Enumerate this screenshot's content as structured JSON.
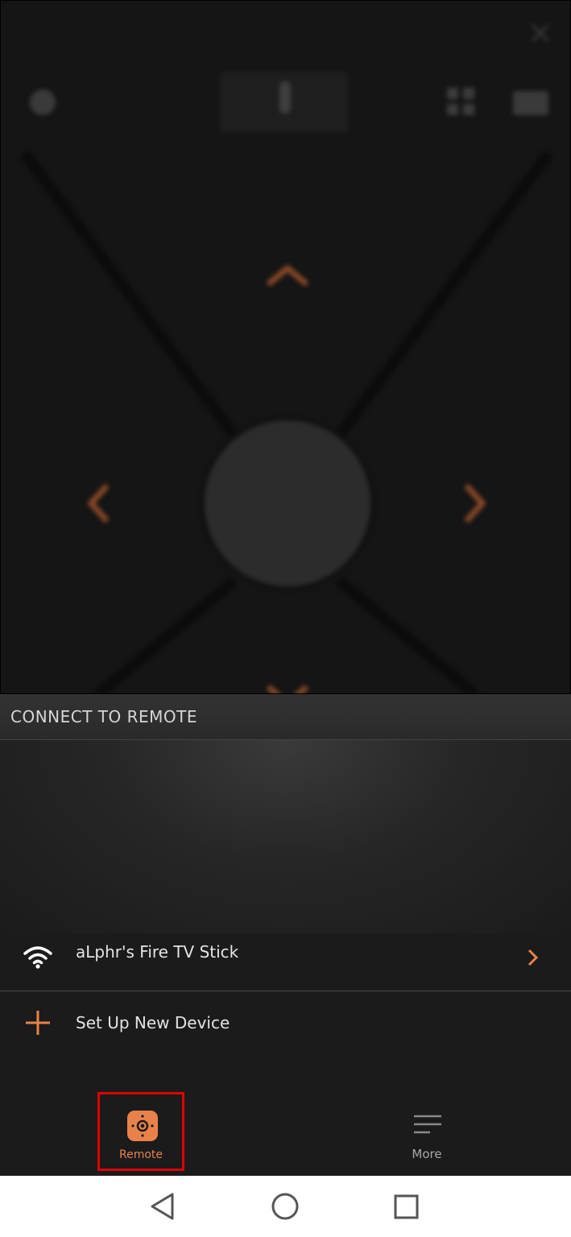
{
  "remote": {
    "icons": [
      "settings-icon",
      "microphone-icon",
      "apps-grid-icon",
      "keyboard-icon",
      "close-icon"
    ],
    "dpad": [
      "chevron-up-icon",
      "chevron-left-icon",
      "chevron-right-icon",
      "chevron-down-icon"
    ],
    "accent": "#e9824a"
  },
  "connect": {
    "title": "CONNECT TO REMOTE",
    "devices": [
      {
        "name": "aLphr's Fire TV Stick",
        "icon": "wifi-icon"
      }
    ],
    "setup_label": "Set Up New Device"
  },
  "tabs": [
    {
      "label": "Remote",
      "active": true,
      "icon": "remote-icon"
    },
    {
      "label": "More",
      "active": false,
      "icon": "menu-icon"
    }
  ],
  "highlight_color": "#e00000"
}
